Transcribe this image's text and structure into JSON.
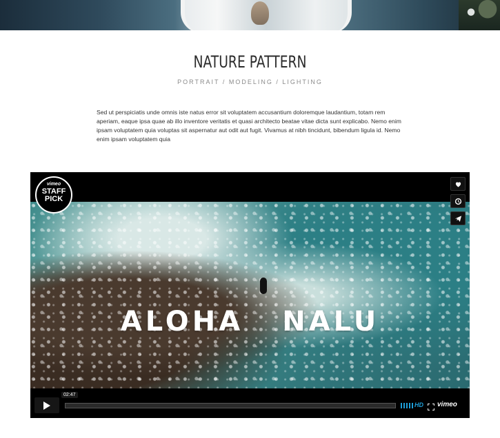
{
  "header": {
    "title": "NATURE PATTERN",
    "subtitle": "PORTRAIT / MODELING / LIGHTING"
  },
  "description": "Sed ut perspiciatis unde omnis iste natus error sit voluptatem accusantium doloremque laudantium, totam rem aperiam, eaque ipsa quae ab illo inventore veritatis et quasi architecto beatae vitae dicta sunt explicabo. Nemo enim ipsam voluptatem quia voluptas sit aspernatur aut odit aut fugit. Vivamus at nibh tincidunt, bibendum ligula id. Nemo enim ipsam voluptatem quia",
  "video": {
    "badge_brand": "vimeo",
    "badge_text": "STAFF PICK",
    "overlay_word_1": "ALOHA",
    "overlay_word_2": "NALU",
    "duration": "02:47",
    "quality": "HD",
    "brand": "vimeo",
    "side_buttons": [
      "heart-icon",
      "clock-icon",
      "send-icon"
    ]
  },
  "colors": {
    "accent": "#1e9fd9",
    "player_bg": "#000000"
  }
}
